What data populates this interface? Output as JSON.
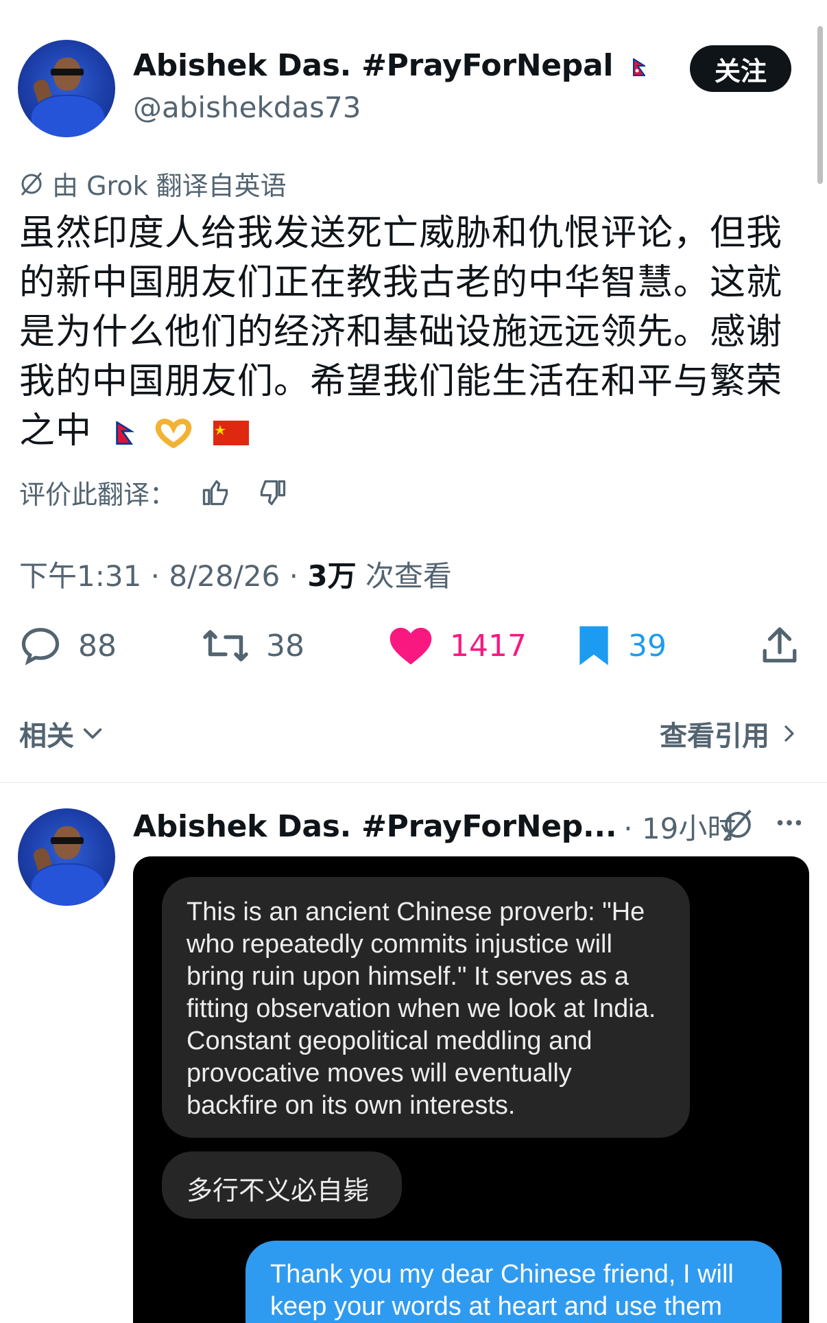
{
  "post": {
    "author_name": "Abishek Das. #PrayForNepal",
    "author_handle": "@abishekdas73",
    "follow_label": "关注",
    "translation_notice": "由 Grok 翻译自英语",
    "text": "虽然印度人给我发送死亡威胁和仇恨评论，但我的新中国朋友们正在教我古老的中华智慧。这就是为什么他们的经济和基础设施远远领先。感谢我的中国朋友们。希望我们能生活在和平与繁荣之中",
    "rate_label": "评价此翻译：",
    "time": "下午1:31 · 8/28/26 · ",
    "views_count": "3万",
    "views_label": " 次查看",
    "counts": {
      "replies": "88",
      "retweets": "38",
      "likes": "1417",
      "bookmarks": "39"
    },
    "related_label": "相关",
    "view_quotes_label": "查看引用"
  },
  "reply": {
    "author_name": "Abishek Das. #PrayForNep...",
    "time": "· 19小时",
    "image_messages": {
      "received_1": "This is an ancient Chinese proverb: \"He who repeatedly commits injustice will bring ruin upon himself.\" It serves as a fitting observation when we look at India. Constant geopolitical meddling and provocative moves will eventually backfire on its own interests.",
      "received_2": "多行不义必自毙",
      "sent_1": "Thank you my dear Chinese friend, I will keep your words at heart and use them"
    }
  },
  "colors": {
    "like": "#f91880",
    "bookmark": "#1d9bf0",
    "secondary_text": "#536471",
    "follow_bg": "#0f1419"
  },
  "icons": [
    "translate-icon",
    "thumb-up-icon",
    "thumb-down-icon",
    "reply-icon",
    "retweet-icon",
    "heart-icon",
    "bookmark-icon",
    "share-icon",
    "chevron-down-icon",
    "chevron-right-icon",
    "more-icon"
  ]
}
